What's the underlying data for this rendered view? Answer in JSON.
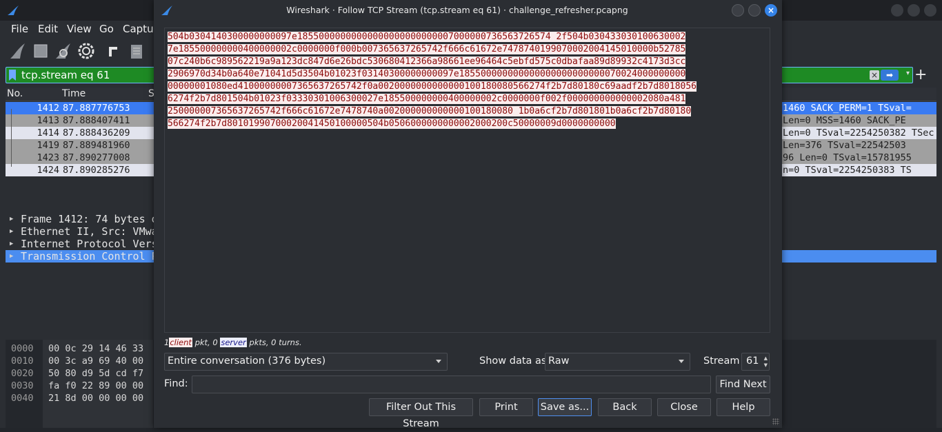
{
  "main_window": {
    "menu": [
      "File",
      "Edit",
      "View",
      "Go",
      "Captur"
    ],
    "filter": {
      "text": "tcp.stream eq 61"
    },
    "columns": [
      "No.",
      "Time",
      "S"
    ],
    "packets": [
      {
        "no": "1412",
        "time": "87.887776753",
        "src": "1",
        "info": "1460 SACK_PERM=1 TSval="
      },
      {
        "no": "1413",
        "time": "87.888407411",
        "src": "1",
        "info": " Len=0 MSS=1460 SACK_PE"
      },
      {
        "no": "1414",
        "time": "87.888436209",
        "src": "1",
        "info": "Len=0 TSval=2254250382 TSec"
      },
      {
        "no": "1419",
        "time": "87.889481960",
        "src": "1",
        "info": "Len=376 TSval=22542503"
      },
      {
        "no": "1423",
        "time": "87.890277008",
        "src": "1",
        "info": "96 Len=0 TSval=15781955"
      },
      {
        "no": "1424",
        "time": "87.890285276",
        "src": "1",
        "info": "n=0 TSval=2254250383 TS"
      }
    ],
    "details": [
      "Frame 1412: 74 bytes o",
      "Ethernet II, Src: VMwa",
      "Internet Protocol Vers",
      "Transmission Control P"
    ],
    "bytes": [
      {
        "offset": "0000",
        "hex": "00 0c 29 14 46 33"
      },
      {
        "offset": "0010",
        "hex": "00 3c a9 69 40 00"
      },
      {
        "offset": "0020",
        "hex": "50 80 d9 5d cd f7"
      },
      {
        "offset": "0030",
        "hex": "fa f0 22 89 00 00"
      },
      {
        "offset": "0040",
        "hex": "21 8d 00 00 00 00"
      }
    ]
  },
  "dialog": {
    "title": "Wireshark · Follow TCP Stream (tcp.stream eq 61) · challenge_refresher.pcapng",
    "stream_lines": [
      "504b0304140300000000097e18550000000000000000000000007000000736563726574 2f504b030433030100630002",
      "7e185500000000400000002c0000000f000b007365637265742f666c61672e7478740199070002004145010000b52785",
      "07c240b6c989562219a9a123dc847d6e26bdc530680412366a98661ee96464c5ebfd575c0dbafaa89d89932c4173d3cc",
      "2906970d34b0a640e71041d5d3504b01023f03140300000000097e185500000000000000000000000070024000000000",
      "00000001080ed41000000007365637265742f0a0020000000000000100180080566274f2b7d80180c69aadf2b7d8018056",
      "6274f2b7d801504b01023f03330301006300027e185500000000400000002c0000000f002f000000000000002080a481",
      "250000007365637265742f666c61672e7478740a002000000000000100180080 1b0a6cf2b7d801801b0a6cf2b7d80180",
      "566274f2b7d80101990700020041450100000504b0506000000000002000200c50000009d0000000000"
    ],
    "summary": {
      "client_count": "1",
      "client_label": "client",
      "middle": "pkt, 0",
      "server_label": "server",
      "tail": "pkts, 0 turns."
    },
    "conversation_select": "Entire conversation (376 bytes)",
    "show_data_label": "Show data as",
    "show_data_value": "Raw",
    "stream_label": "Stream",
    "stream_value": "61",
    "find_label": "Find:",
    "find_value": "",
    "find_next_label": "Find Next",
    "buttons": {
      "filter_out": "Filter Out This Stream",
      "print": "Print",
      "save_as": "Save as...",
      "back": "Back",
      "close": "Close",
      "help": "Help"
    }
  }
}
